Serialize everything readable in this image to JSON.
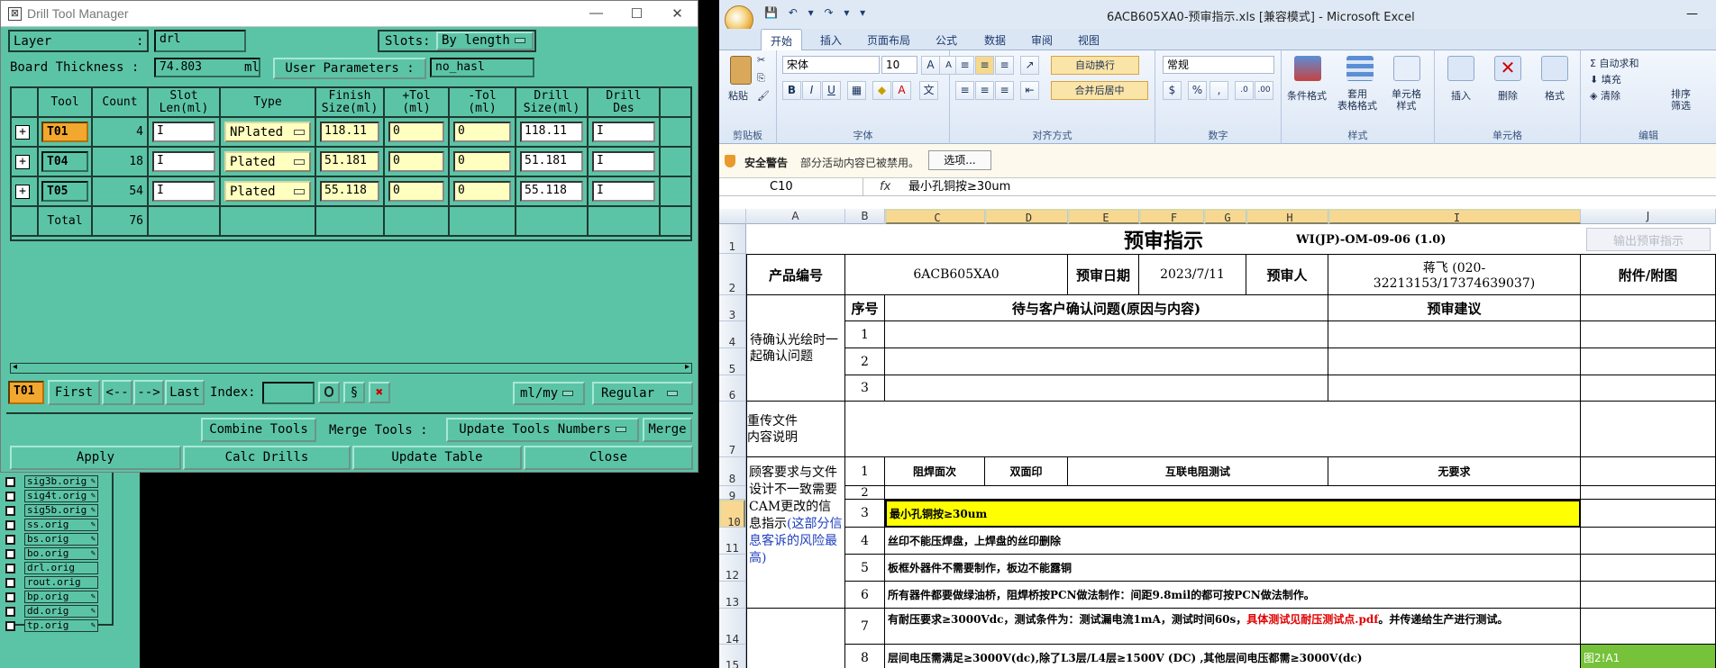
{
  "dtm": {
    "title": "Drill Tool Manager",
    "layer_label": "Layer",
    "layer_value": "drl",
    "slots_label": "Slots:",
    "slots_value": "By length",
    "thickness_label": "Board Thickness :",
    "thickness_value": "74.803",
    "thickness_unit": "ml",
    "user_params_label": "User Parameters :",
    "user_params_value": "no_hasl",
    "headers": [
      "Tool",
      "Count",
      "Slot\nLen(ml)",
      "Type",
      "Finish\nSize(ml)",
      "+Tol\n(ml)",
      "-Tol\n(ml)",
      "Drill\nSize(ml)",
      "Drill\nDes"
    ],
    "rows": [
      {
        "tool": "T01",
        "count": "4",
        "type": "NPlated",
        "finish": "118.11",
        "ptol": "0",
        "ntol": "0",
        "drill": "118.11"
      },
      {
        "tool": "T04",
        "count": "18",
        "type": "Plated",
        "finish": "51.181",
        "ptol": "0",
        "ntol": "0",
        "drill": "51.181"
      },
      {
        "tool": "T05",
        "count": "54",
        "type": "Plated",
        "finish": "55.118",
        "ptol": "0",
        "ntol": "0",
        "drill": "55.118"
      }
    ],
    "total_label": "Total",
    "total_value": "76",
    "nav": {
      "current": "T01",
      "first": "First",
      "prev": "<--",
      "next": "-->",
      "last": "Last",
      "index_label": "Index:",
      "units": "ml/my",
      "mode": "Regular"
    },
    "buttons": {
      "combine": "Combine Tools",
      "merge_label": "Merge Tools :",
      "merge_mode": "Update Tools Numbers",
      "merge": "Merge",
      "apply": "Apply",
      "calc": "Calc Drills",
      "update": "Update Table",
      "close": "Close"
    }
  },
  "layers": [
    "sig3b.orig",
    "sig4t.orig",
    "sig5b.orig",
    "ss.orig",
    "bs.orig",
    "bo.orig",
    "drl.orig",
    "rout.orig",
    "bp.orig",
    "dd.orig",
    "tp.orig"
  ],
  "excel": {
    "title": "6ACB605XA0-预审指示.xls  [兼容模式] - Microsoft Excel",
    "tabs": [
      "开始",
      "插入",
      "页面布局",
      "公式",
      "数据",
      "审阅",
      "视图"
    ],
    "ribbon": {
      "paste": "粘贴",
      "clipboard": "剪贴板",
      "font_name": "宋体",
      "font_size": "10",
      "font_group": "字体",
      "wrap": "自动换行",
      "merge_center": "合并后居中",
      "align_group": "对齐方式",
      "number_format": "常规",
      "number_group": "数字",
      "cond_format": "条件格式",
      "table_format": "套用\n表格格式",
      "cell_style": "单元格\n样式",
      "style_group": "样式",
      "insert": "插入",
      "delete": "删除",
      "format": "格式",
      "cells_group": "单元格",
      "autosum": "自动求和",
      "fill": "填充",
      "clear": "清除",
      "sort": "排序\n筛选",
      "edit_group": "编辑"
    },
    "security": {
      "title": "安全警告",
      "msg": "部分活动内容已被禁用。",
      "options": "选项..."
    },
    "namebox": "C10",
    "formula": "最小孔铜按≥30um",
    "columns": [
      "A",
      "B",
      "C",
      "D",
      "E",
      "F",
      "G",
      "H",
      "I",
      "J"
    ],
    "rows": [
      "1",
      "2",
      "3",
      "4",
      "5",
      "6",
      "7",
      "8",
      "9",
      "10",
      "11",
      "12",
      "13",
      "14",
      "15"
    ],
    "sheet": {
      "title": "预审指示",
      "doc_no": "WI(JP)-OM-09-06 (1.0)",
      "export_btn": "输出预审指示",
      "product_label": "产品编号",
      "product_value": "6ACB605XA0",
      "date_label": "预审日期",
      "date_value": "2023/7/11",
      "reviewer_label": "预审人",
      "reviewer_value": "蒋飞 (020-32213153/17374639037)",
      "attach_label": "附件/附图",
      "pending_label": "待确认光绘时一起确认问题",
      "seq_label": "序号",
      "issue_label": "待与客户确认问题(原因与内容)",
      "suggest_label": "预审建议",
      "reupload_label": "重传文件\n内容说明",
      "mismatch_label": "顾客要求与文件设计不一致需要CAM更改的信息指示",
      "mismatch_note": "(这部分信息客诉的风险最高)",
      "r8": [
        "阻焊面次",
        "双面印",
        "互联电阻测试",
        "无要求"
      ],
      "r10": "最小孔铜按≥30um",
      "r11": "丝印不能压焊盘，上焊盘的丝印删除",
      "r12": "板框外器件不需要制作，板边不能露铜",
      "r13": "所有器件都要做绿油桥，阻焊桥按PCN做法制作：间距9.8mil的都可按PCN做法制作。",
      "r14a": "有耐压要求≥3000Vdc，测试条件为：测试漏电流1mA，测试时间60s，",
      "r14b": "具体测试见耐压测试点.pdf",
      "r14c": "。并传递给生产进行测试。",
      "r15": "层间电压需满足≥3000V(dc),除了L3层/L4层≥1500V (DC) ,其他层间电压都需≥3000V(dc)",
      "r15_j": "图2!A1",
      "seq": [
        "1",
        "2",
        "3",
        "1",
        "2",
        "3",
        "4",
        "5",
        "6",
        "7",
        "8"
      ]
    }
  }
}
